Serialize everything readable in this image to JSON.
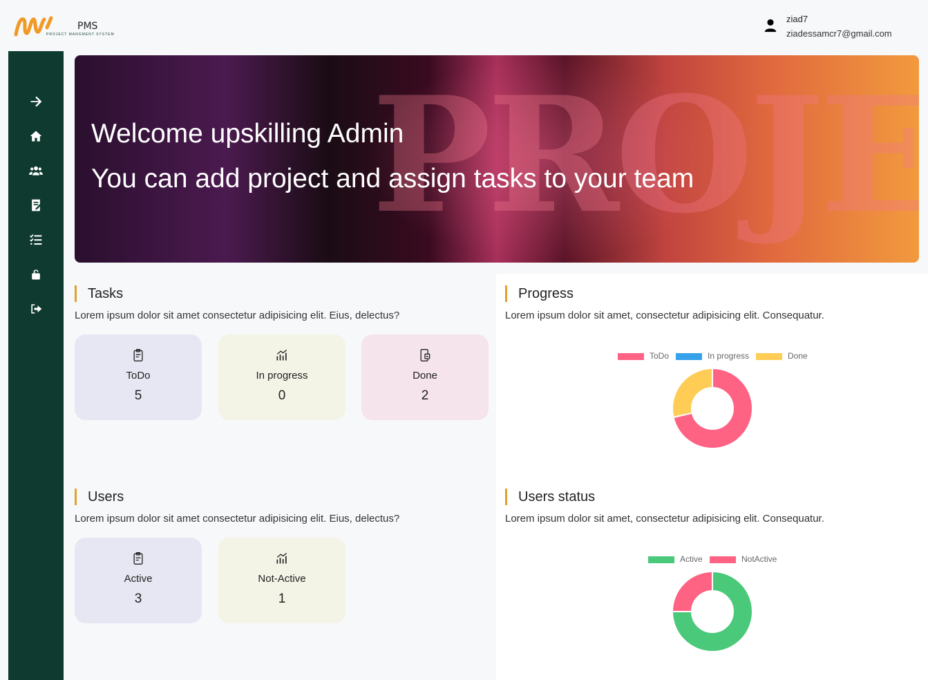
{
  "header": {
    "logo_title": "PMS",
    "logo_subtitle": "PROJECT MANGMENT SYSTEM",
    "user_name": "ziad7",
    "user_email": "ziadessamcr7@gmail.com"
  },
  "sidebar": {
    "items": [
      {
        "name": "expand",
        "icon": "arrow-right-icon"
      },
      {
        "name": "home",
        "icon": "home-icon"
      },
      {
        "name": "users",
        "icon": "users-icon"
      },
      {
        "name": "projects",
        "icon": "projects-icon"
      },
      {
        "name": "tasks",
        "icon": "task-list-icon"
      },
      {
        "name": "change-password",
        "icon": "unlock-icon"
      },
      {
        "name": "logout",
        "icon": "logout-icon"
      }
    ]
  },
  "banner": {
    "line1": "Welcome upskilling Admin",
    "line2": "You can add project and assign tasks to your team",
    "background_word": "PROJECTS"
  },
  "tasks": {
    "title": "Tasks",
    "description": "Lorem ipsum dolor sit amet consectetur adipisicing elit. Eius, delectus?",
    "cards": [
      {
        "label": "ToDo",
        "value": "5",
        "icon": "clipboard-icon"
      },
      {
        "label": "In progress",
        "value": "0",
        "icon": "chart-up-icon"
      },
      {
        "label": "Done",
        "value": "2",
        "icon": "phone-check-icon"
      }
    ]
  },
  "progress": {
    "title": "Progress",
    "description": "Lorem ipsum dolor sit amet, consectetur adipisicing elit. Consequatur."
  },
  "users": {
    "title": "Users",
    "description": "Lorem ipsum dolor sit amet consectetur adipisicing elit. Eius, delectus?",
    "cards": [
      {
        "label": "Active",
        "value": "3",
        "icon": "clipboard-icon"
      },
      {
        "label": "Not-Active",
        "value": "1",
        "icon": "chart-up-icon"
      }
    ]
  },
  "users_status": {
    "title": "Users status",
    "description": "Lorem ipsum dolor sit amet, consectetur adipisicing elit. Consequatur."
  },
  "chart_data": [
    {
      "type": "pie",
      "variant": "doughnut",
      "categories": [
        "ToDo",
        "In progress",
        "Done"
      ],
      "values": [
        5,
        0,
        2
      ],
      "colors": [
        "#ff6384",
        "#36a2eb",
        "#ffcd56"
      ],
      "legend": "top"
    },
    {
      "type": "pie",
      "variant": "doughnut",
      "categories": [
        "Active",
        "NotActive"
      ],
      "values": [
        3,
        1
      ],
      "colors": [
        "#4bc97a",
        "#ff6384"
      ],
      "legend": "top"
    }
  ]
}
